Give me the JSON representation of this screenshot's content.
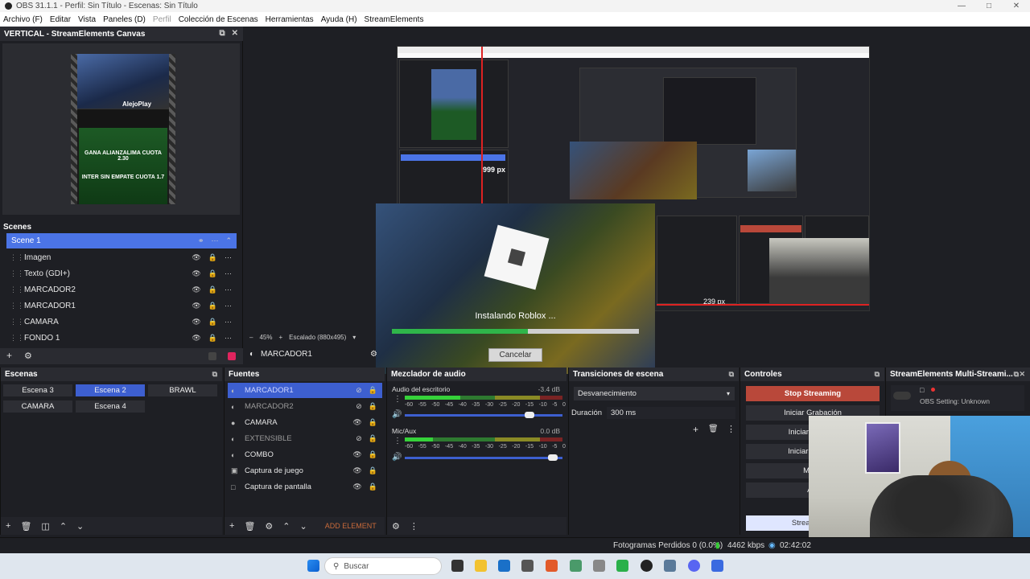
{
  "window": {
    "title": "OBS 31.1.1 - Perfil: Sin Título - Escenas: Sin Título"
  },
  "menu": [
    "Archivo (F)",
    "Editar",
    "Vista",
    "Paneles (D)",
    "Perfil",
    "Colección de Escenas",
    "Herramientas",
    "Ayuda (H)",
    "StreamElements"
  ],
  "vertical_dock": {
    "title": "VERTICAL - StreamElements Canvas",
    "preview_brand": "AlejoPlay",
    "preview_text1": "GANA ALIANZALIMA CUOTA 2.30",
    "preview_text2": "INTER SIN EMPATE CUOTA 1.7",
    "scenes_label": "Scenes",
    "scene_selected": "Scene 1",
    "sources": [
      "Imagen",
      "Texto (GDI+)",
      "MARCADOR2",
      "MARCADOR1",
      "CAMARA",
      "FONDO 1"
    ]
  },
  "preview": {
    "zoom": "45%",
    "scaling": "Escalado (880x495)",
    "selected_source": "MARCADOR1",
    "px_readout": "999 px",
    "px_readout2": "239 px"
  },
  "roblox": {
    "status": "Instalando Roblox ...",
    "cancel": "Cancelar",
    "progress": 0.55
  },
  "scenes_dock": {
    "title": "Escenas",
    "scenes": [
      "Escena 3",
      "Escena 2",
      "BRAWL",
      "CAMARA",
      "Escena 4"
    ],
    "active": "Escena 2"
  },
  "sources_dock": {
    "title": "Fuentes",
    "items": [
      {
        "label": "MARCADOR1",
        "icon": "image-icon"
      },
      {
        "label": "MARCADOR2",
        "icon": "image-icon"
      },
      {
        "label": "CAMARA",
        "icon": "camera-icon"
      },
      {
        "label": "EXTENSIBLE",
        "icon": "globe-icon"
      },
      {
        "label": "COMBO",
        "icon": "globe-icon"
      },
      {
        "label": "Captura de juego",
        "icon": "gamepad-icon"
      },
      {
        "label": "Captura de pantalla",
        "icon": "monitor-icon"
      }
    ],
    "add_element": "ADD ELEMENT"
  },
  "mixer": {
    "title": "Mezclador de audio",
    "channels": [
      {
        "name": "Audio del escritorio",
        "db": "-3.4 dB",
        "level": 0.35,
        "volume": 0.82
      },
      {
        "name": "Mic/Aux",
        "db": "0.0 dB",
        "level": 0.18,
        "volume": 0.97
      }
    ],
    "scale": [
      "-60",
      "-55",
      "-50",
      "-45",
      "-40",
      "-35",
      "-30",
      "-25",
      "-20",
      "-15",
      "-10",
      "-5",
      "0"
    ]
  },
  "transitions": {
    "title": "Transiciones de escena",
    "selected": "Desvanecimiento",
    "duration_label": "Duración",
    "duration": "300 ms"
  },
  "controls": {
    "title": "Controles",
    "buttons": [
      "Stop Streaming",
      "Iniciar Grabación",
      "Iniciar el Búfer",
      "Iniciar Cámara",
      "Modo",
      "Aju"
    ],
    "se_button": "StreamElem"
  },
  "multistream": {
    "title": "StreamElements Multi-Streami...",
    "setting": "OBS Setting: Unknown"
  },
  "status": {
    "dropped": "Fotogramas Perdidos 0 (0.0%)",
    "kbps": "4462 kbps",
    "time": "02:42:02"
  },
  "taskbar": {
    "search": "Buscar"
  },
  "colors": {
    "accent": "#4b74e6",
    "stop": "#b9483a"
  }
}
